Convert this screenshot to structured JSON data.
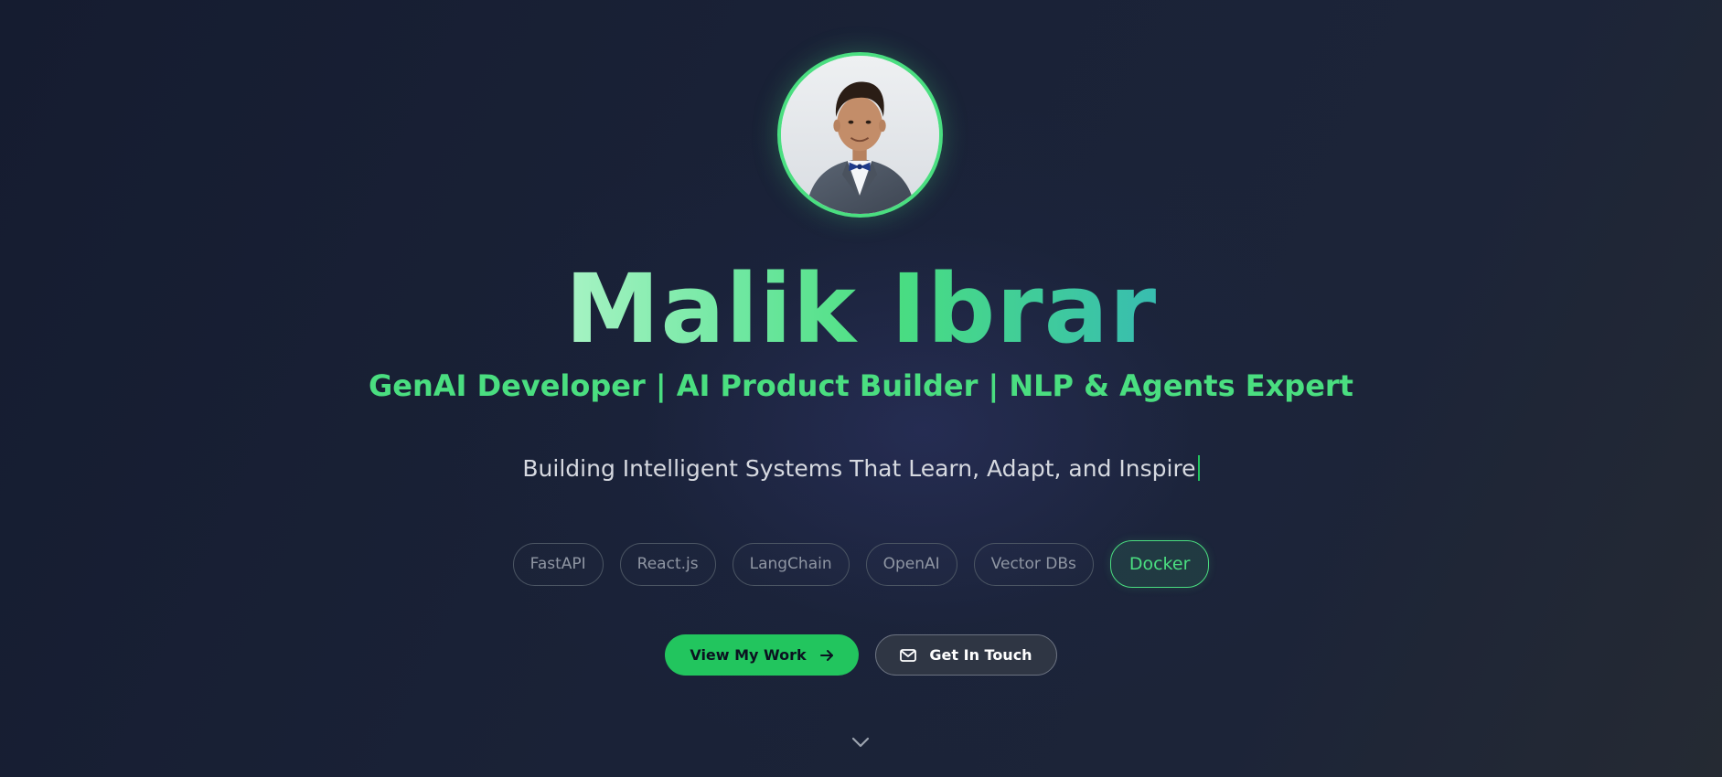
{
  "hero": {
    "name": "Malik Ibrar",
    "roles": "GenAI Developer | AI Product Builder | NLP & Agents Expert",
    "tagline": "Building Intelligent Systems That Learn, Adapt, and Inspire"
  },
  "avatar": {
    "alt": "Malik Ibrar profile photo",
    "border_color": "#4ade80"
  },
  "tech_stack": [
    {
      "label": "FastAPI",
      "active": false
    },
    {
      "label": "React.js",
      "active": false
    },
    {
      "label": "LangChain",
      "active": false
    },
    {
      "label": "OpenAI",
      "active": false
    },
    {
      "label": "Vector DBs",
      "active": false
    },
    {
      "label": "Docker",
      "active": true
    }
  ],
  "buttons": {
    "primary_label": "View My Work",
    "primary_icon": "arrow-right-icon",
    "secondary_label": "Get In Touch",
    "secondary_icon": "mail-icon"
  },
  "scroll_indicator": {
    "icon": "chevron-down-icon"
  },
  "colors": {
    "accent": "#4ade80",
    "accent_button": "#22c55e",
    "background": "#1a2237",
    "chip_border": "#4b5563"
  }
}
